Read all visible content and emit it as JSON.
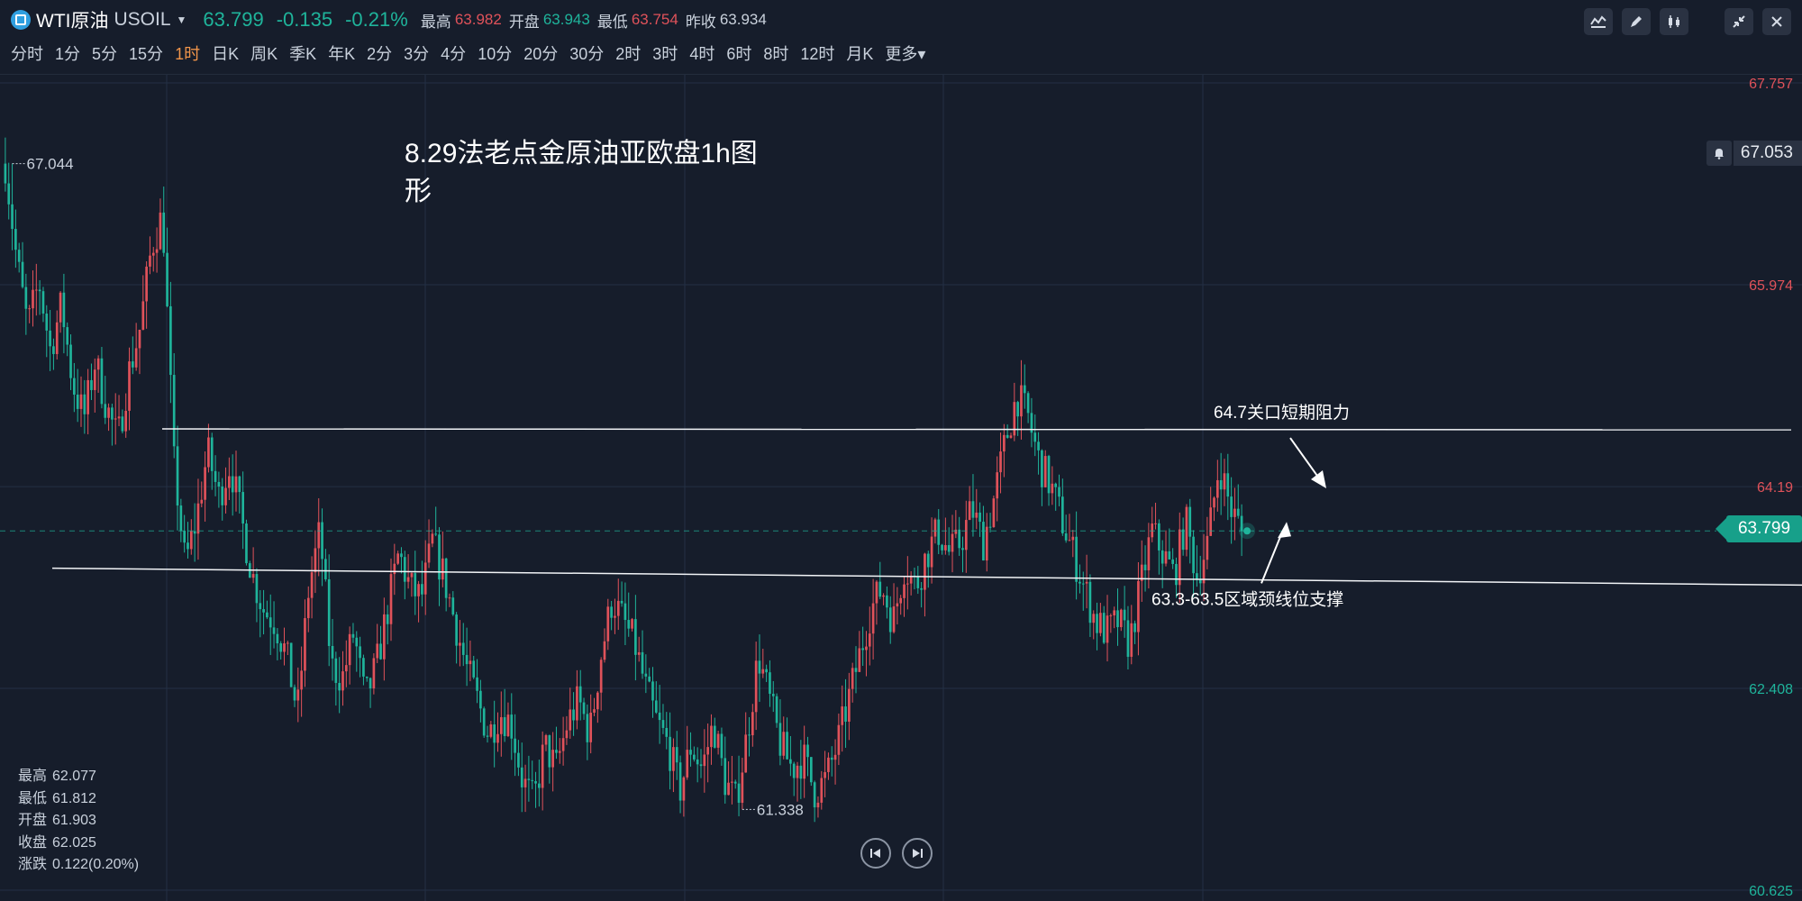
{
  "header": {
    "symbol_name": "WTI原油",
    "symbol_code": "USOIL",
    "price": "63.799",
    "change": "-0.135",
    "change_pct": "-0.21%",
    "high_label": "最高",
    "high_value": "63.982",
    "open_label": "开盘",
    "open_value": "63.943",
    "low_label": "最低",
    "low_value": "63.754",
    "prev_label": "昨收",
    "prev_value": "63.934"
  },
  "periods": [
    "分时",
    "1分",
    "5分",
    "15分",
    "1时",
    "日K",
    "周K",
    "季K",
    "年K",
    "2分",
    "3分",
    "4分",
    "10分",
    "20分",
    "30分",
    "2时",
    "3时",
    "4时",
    "6时",
    "8时",
    "12时",
    "月K",
    "更多"
  ],
  "active_period": "1时",
  "ohlc_panel": {
    "high_label": "最高",
    "high": "62.077",
    "low_label": "最低",
    "low": "61.812",
    "open_label": "开盘",
    "open": "61.903",
    "close_label": "收盘",
    "close": "62.025",
    "change_label": "涨跌",
    "change": "0.122(0.20%)"
  },
  "current_price_tag": "63.799",
  "alert_price": "67.053",
  "colors": {
    "up": "#e0525a",
    "down": "#1fb49b",
    "bg": "#161d2b",
    "grid": "#243044"
  },
  "chart_data": {
    "type": "candlestick",
    "title": "8.29法老点金原油亚欧盘1h图形",
    "y_axis_labels": [
      {
        "value": 67.757,
        "text": "67.757",
        "color": "red"
      },
      {
        "value": 65.974,
        "text": "65.974",
        "color": "red"
      },
      {
        "value": 64.19,
        "text": "64.19",
        "color": "red"
      },
      {
        "value": 62.408,
        "text": "62.408",
        "color": "green"
      },
      {
        "value": 60.625,
        "text": "60.625",
        "color": "green"
      }
    ],
    "ylim": [
      60.625,
      67.757
    ],
    "max_marker": {
      "value": 67.044,
      "text": "67.044"
    },
    "min_marker": {
      "value": 61.338,
      "text": "61.338"
    },
    "current_price": 63.799,
    "annotations": [
      {
        "text": "64.7关口短期阻力",
        "level": 64.7
      },
      {
        "text": "63.3-63.5区域颈线位支撑",
        "level": 63.5
      }
    ],
    "price_path": [
      67.044,
      66.2,
      65.6,
      66.0,
      65.4,
      65.8,
      65.1,
      64.8,
      65.3,
      64.9,
      64.6,
      65.2,
      65.6,
      66.3,
      66.6,
      64.4,
      63.5,
      63.9,
      64.5,
      64.1,
      64.4,
      63.9,
      63.4,
      63.1,
      63.0,
      62.7,
      62.2,
      63.3,
      63.8,
      62.6,
      62.5,
      62.9,
      62.3,
      62.6,
      63.1,
      63.6,
      63.3,
      63.2,
      63.7,
      63.4,
      63.0,
      62.6,
      62.3,
      62.0,
      62.2,
      62.1,
      61.6,
      61.4,
      61.9,
      61.7,
      62.1,
      62.3,
      62.0,
      62.7,
      63.2,
      63.0,
      62.8,
      62.4,
      62.1,
      61.9,
      61.5,
      61.9,
      61.7,
      62.1,
      61.6,
      61.4,
      62.0,
      62.7,
      62.3,
      61.9,
      61.7,
      61.8,
      61.5,
      61.6,
      61.9,
      62.3,
      62.7,
      63.1,
      63.3,
      63.0,
      63.5,
      63.3,
      63.6,
      63.8,
      63.6,
      63.7,
      64.0,
      63.7,
      64.1,
      64.6,
      65.0,
      64.8,
      64.4,
      64.2,
      63.9,
      63.6,
      63.3,
      63.0,
      62.9,
      63.0,
      62.8,
      63.3,
      63.8,
      63.6,
      63.4,
      63.9,
      63.4,
      63.7,
      64.4,
      64.0,
      63.8
    ]
  }
}
